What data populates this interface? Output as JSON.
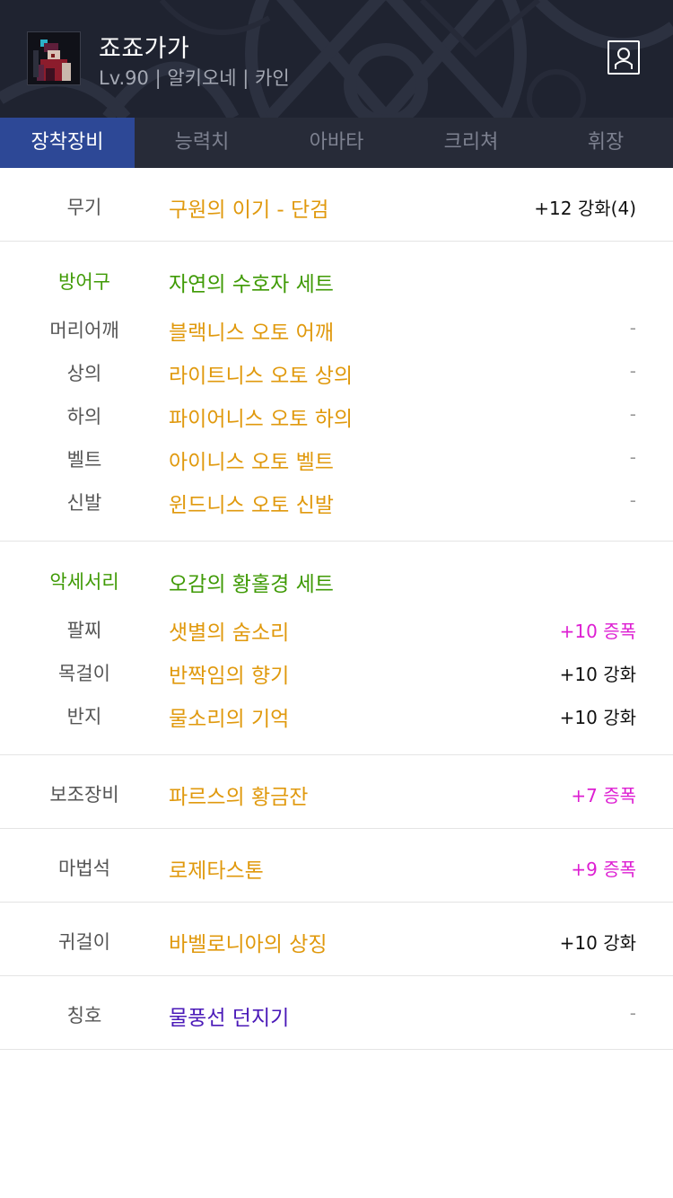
{
  "character": {
    "name": "죠죠가가",
    "info": "Lv.90 | 알키오네 | 카인"
  },
  "tabs": [
    {
      "label": "장착장비",
      "active": true
    },
    {
      "label": "능력치",
      "active": false
    },
    {
      "label": "아바타",
      "active": false
    },
    {
      "label": "크리쳐",
      "active": false
    },
    {
      "label": "휘장",
      "active": false
    }
  ],
  "weapon": {
    "label": "무기",
    "name": "구원의 이기 - 단검",
    "value": "+12 강화(4)"
  },
  "armor": {
    "label": "방어구",
    "set_name": "자연의 수호자 세트",
    "items": [
      {
        "label": "머리어깨",
        "name": "블랙니스 오토 어깨",
        "value": "-"
      },
      {
        "label": "상의",
        "name": "라이트니스 오토 상의",
        "value": "-"
      },
      {
        "label": "하의",
        "name": "파이어니스 오토 하의",
        "value": "-"
      },
      {
        "label": "벨트",
        "name": "아이니스 오토 벨트",
        "value": "-"
      },
      {
        "label": "신발",
        "name": "윈드니스 오토 신발",
        "value": "-"
      }
    ]
  },
  "accessory": {
    "label": "악세서리",
    "set_name": "오감의 황홀경 세트",
    "items": [
      {
        "label": "팔찌",
        "name": "샛별의 숨소리",
        "value": "+10 증폭"
      },
      {
        "label": "목걸이",
        "name": "반짝임의 향기",
        "value": "+10 강화"
      },
      {
        "label": "반지",
        "name": "물소리의 기억",
        "value": "+10 강화"
      }
    ]
  },
  "support": {
    "label": "보조장비",
    "name": "파르스의 황금잔",
    "value": "+7 증폭"
  },
  "magic_stone": {
    "label": "마법석",
    "name": "로제타스톤",
    "value": "+9 증폭"
  },
  "earring": {
    "label": "귀걸이",
    "name": "바벨로니아의 상징",
    "value": "+10 강화"
  },
  "title": {
    "label": "칭호",
    "name": "물풍선 던지기",
    "value": "-"
  },
  "colors": {
    "header_bg": "#1f2330",
    "tab_active": "#2d4896",
    "item_gold": "#e0990d",
    "set_green": "#3f9a05",
    "amplify_magenta": "#dd1ed2",
    "title_purple": "#4a19b8"
  },
  "icons": {
    "profile": "user-profile-icon"
  }
}
